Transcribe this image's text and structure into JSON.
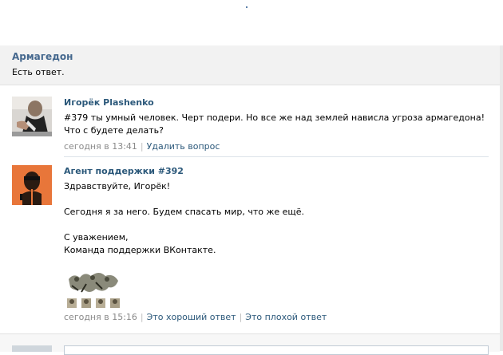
{
  "ticket": {
    "title": "Армагедон",
    "status": "Есть ответ."
  },
  "messages": [
    {
      "author": "Игорёк Plashenko",
      "text": "#379 ты умный человек. Черт подери. Но все же над землей нависла угроза армагедона! Что с будете делать?",
      "time": "сегодня в 13:41",
      "action": "Удалить вопрос"
    },
    {
      "author": "Агент поддержки #392",
      "greeting": "Здравствуйте, Игорёк!",
      "body": "Сегодня я за него. Будем спасать мир, что же ещё.",
      "sign1": "С уважением,",
      "sign2": "Команда поддержки ВКонтакте.",
      "time": "сегодня в 15:16",
      "good": "Это хороший ответ",
      "bad": "Это плохой ответ"
    }
  ],
  "colors": {
    "link": "#2b587a",
    "title": "#45688e",
    "agent_avatar_bg": "#e8763a"
  }
}
